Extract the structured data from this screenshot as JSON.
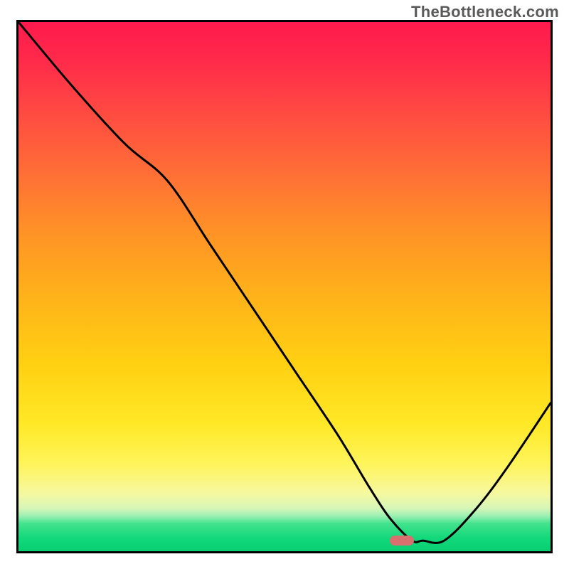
{
  "watermark": "TheBottleneck.com",
  "chart_data": {
    "type": "line",
    "title": "",
    "xlabel": "",
    "ylabel": "",
    "xlim": [
      0,
      100
    ],
    "ylim": [
      0,
      100
    ],
    "series": [
      {
        "name": "bottleneck-curve",
        "x": [
          0,
          10,
          20,
          28,
          36,
          44,
          52,
          60,
          66,
          70,
          74,
          76,
          80,
          86,
          92,
          100
        ],
        "values": [
          100,
          88,
          77,
          70,
          58,
          46,
          34,
          22,
          12,
          6,
          2,
          2,
          2,
          8,
          16,
          28
        ]
      }
    ],
    "marker": {
      "x": 72,
      "y": 2,
      "label": "optimal-point"
    },
    "gradient_stops": [
      {
        "pos": 0,
        "color": "#ff1a4d"
      },
      {
        "pos": 50,
        "color": "#ffb31a"
      },
      {
        "pos": 90,
        "color": "#fff45a"
      },
      {
        "pos": 100,
        "color": "#08cf71"
      }
    ]
  }
}
